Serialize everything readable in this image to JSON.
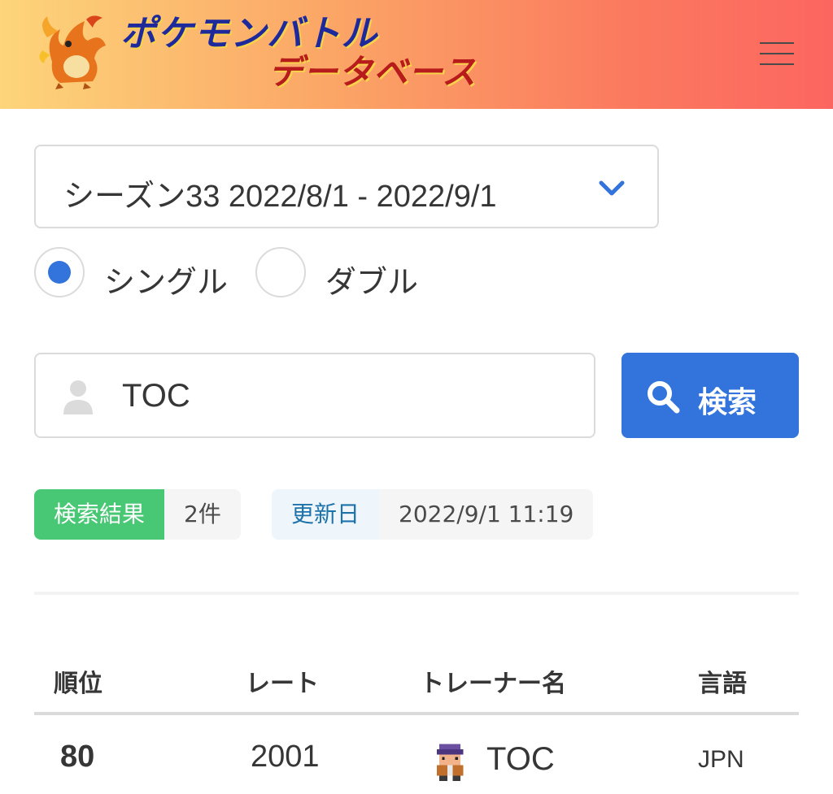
{
  "header": {
    "logo_line1": "ポケモンバトル",
    "logo_line2": "データベース",
    "menu_icon": "hamburger-icon",
    "gradient_colors": [
      "#fdd57a",
      "#fc6660"
    ]
  },
  "season": {
    "selected": "シーズン33  2022/8/1 - 2022/9/1",
    "chevron_icon": "chevron-down-icon"
  },
  "battle_mode": {
    "options": [
      {
        "label": "シングル",
        "selected": true
      },
      {
        "label": "ダブル",
        "selected": false
      }
    ]
  },
  "search": {
    "value": "TOC",
    "user_icon": "user-icon",
    "button_label": "検索",
    "button_icon": "search-icon",
    "button_color": "#3273dc"
  },
  "result_tags": {
    "result_label": "検索結果",
    "result_count": "2件",
    "updated_label": "更新日",
    "updated_value": "2022/9/1 11:19"
  },
  "table": {
    "headers": [
      "順位",
      "レート",
      "トレーナー名",
      "言語"
    ],
    "rows": [
      {
        "rank": "80",
        "rate": "2001",
        "trainer": "TOC",
        "lang": "JPN",
        "avatar_icon": "trainer-sprite-icon"
      }
    ]
  },
  "colors": {
    "primary": "#3273dc",
    "success": "#48c774",
    "info_text": "#1d72aa"
  }
}
